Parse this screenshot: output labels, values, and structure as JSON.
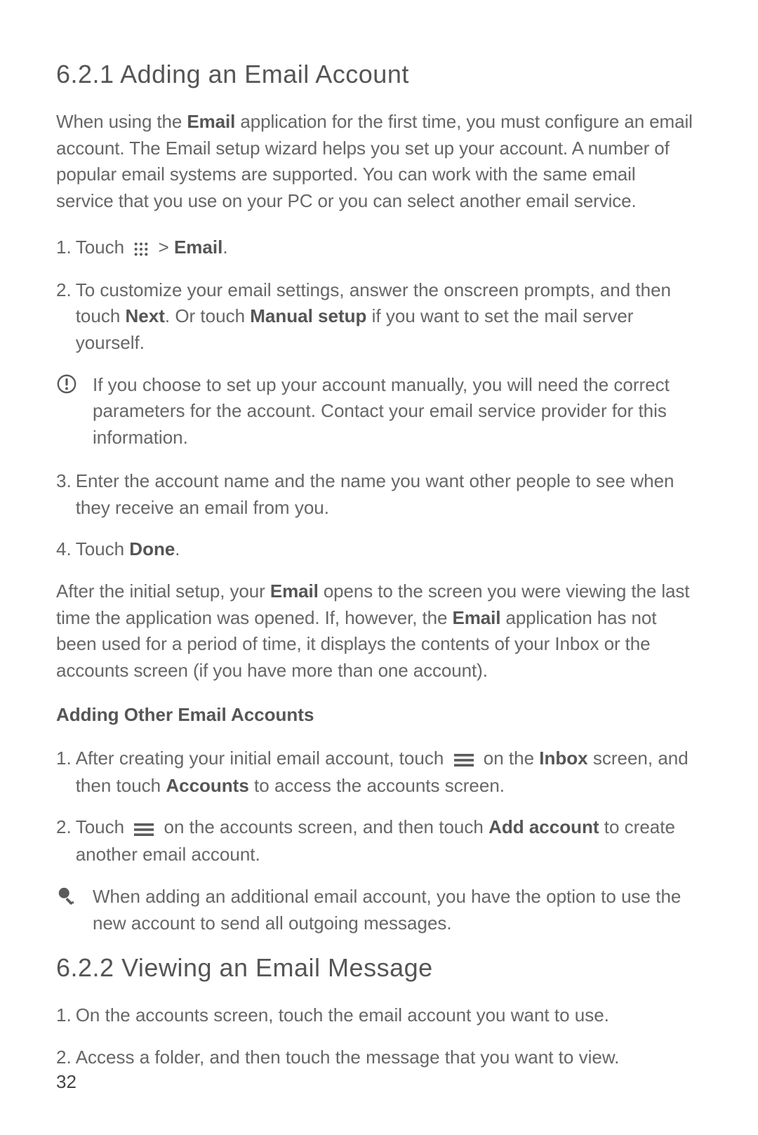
{
  "section1": {
    "heading": "6.2.1  Adding an Email Account",
    "intro_parts": {
      "p1a": "When using the ",
      "email_bold": "Email",
      "p1b": " application for the first time, you must configure an email account. The Email setup wizard helps you set up your account. A number of popular email systems are supported. You can work with the same email service that you use on your PC or you can select another email service."
    },
    "step1": {
      "num": "1. ",
      "a": "Touch ",
      "b": " > ",
      "email_bold": "Email",
      "c": "."
    },
    "step2": {
      "num": "2. ",
      "a": "To customize your email settings, answer the onscreen prompts, and then touch ",
      "next_bold": "Next",
      "b": ". Or touch ",
      "manual_bold": "Manual setup",
      "c": " if you want to set the mail server yourself."
    },
    "note": "If you choose to set up your account manually, you will need the correct parameters for the account. Contact your email service provider for this information.",
    "step3": {
      "num": "3. ",
      "a": "Enter the account name and the name you want other people to see when they receive an email from you."
    },
    "step4": {
      "num": "4. ",
      "a": "Touch ",
      "done_bold": "Done",
      "b": "."
    },
    "after_parts": {
      "a": "After the initial setup, your ",
      "email_bold1": "Email",
      "b": " opens to the screen you were viewing the last time the application was opened. If, however, the ",
      "email_bold2": "Email",
      "c": " application has not been used for a period of time, it displays the contents of your Inbox or the accounts screen (if you have more than one account)."
    },
    "sub_heading": "Adding Other Email Accounts",
    "ostep1": {
      "num": "1. ",
      "a": "After creating your initial email account, touch ",
      "b": " on the ",
      "inbox_bold": "Inbox",
      "c": " screen, and then touch ",
      "accounts_bold": "Accounts",
      "d": " to access the accounts screen."
    },
    "ostep2": {
      "num": "2. ",
      "a": "Touch ",
      "b": " on the accounts screen, and then touch ",
      "add_bold": "Add account",
      "c": " to create another email account."
    },
    "tip": "When adding an additional email account, you have the option to use the new account to send all outgoing messages."
  },
  "section2": {
    "heading": "6.2.2  Viewing an Email Message",
    "step1": {
      "num": "1. ",
      "a": "On the accounts screen, touch the email account you want to use."
    },
    "step2": {
      "num": "2. ",
      "a": "Access a folder, and then touch the message that you want to view."
    }
  },
  "page_number": "32"
}
